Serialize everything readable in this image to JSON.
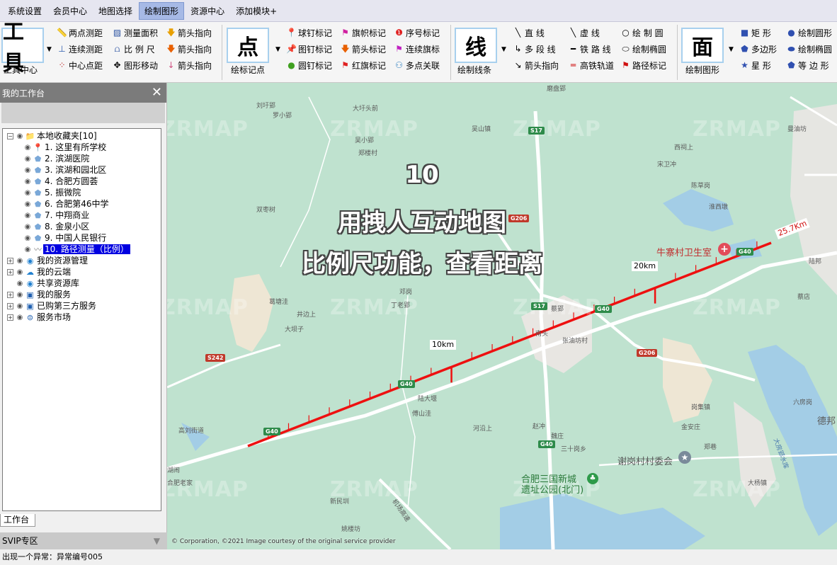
{
  "menu": [
    "系统设置",
    "会员中心",
    "地图选择",
    "绘制图形",
    "资源中心",
    "添加模块+"
  ],
  "ribbon": {
    "tool_group": {
      "big": "工具",
      "label": "工具中心",
      "buttons": [
        [
          "两点测距",
          "测量面积",
          "箭头指向"
        ],
        [
          "连续测距",
          "比 例 尺",
          "箭头指向"
        ],
        [
          "中心点距",
          "图形移动",
          "箭头指向"
        ]
      ]
    },
    "point_group": {
      "big": "点",
      "label": "绘标记点",
      "buttons": [
        [
          "球钉标记",
          "旗帜标记",
          "序号标记"
        ],
        [
          "图钉标记",
          "箭头标记",
          "连续旗标"
        ],
        [
          "圆钉标记",
          "红旗标记",
          "多点关联"
        ]
      ]
    },
    "line_group": {
      "big": "线",
      "label": "绘制线条",
      "buttons": [
        [
          "直  线",
          "虚  线",
          "绘 制 圆"
        ],
        [
          "多 段 线",
          "铁 路 线",
          "绘制椭圆"
        ],
        [
          "箭头指向",
          "高铁轨道",
          "路径标记"
        ]
      ]
    },
    "face_group": {
      "big": "面",
      "label": "绘制图形",
      "buttons": [
        [
          "矩  形",
          "绘制圆形"
        ],
        [
          "多边形",
          "绘制椭圆"
        ],
        [
          "星  形",
          "等 边 形"
        ]
      ]
    }
  },
  "sidebar": {
    "title": "我的工作台",
    "tree": {
      "root": "本地收藏夹[10]",
      "items": [
        "1. 这里有所学校",
        "2. 滨湖医院",
        "3. 滨湖和园北区",
        "4. 合肥方圆荟",
        "5. 振微院",
        "6. 合肥第46中学",
        "7. 中翔商业",
        "8. 金泉小区",
        "9. 中国人民银行",
        "10. 路径测量（比例）"
      ],
      "others": [
        "我的资源管理",
        "我的云端",
        "共享资源库",
        "我的服务",
        "已购第三方服务",
        "服务市场"
      ]
    },
    "tab": "工作台",
    "svip": "SVIP专区"
  },
  "map": {
    "overlay": [
      "10",
      "用拽人互动地图",
      "比例尺功能，查看距离"
    ],
    "watermark": "ZRMAP",
    "km_labels": [
      "10km",
      "20km",
      "25.7Km"
    ],
    "pois": [
      "牛寨村卫生室",
      "谢岗村村委会",
      "合肥三国新城",
      "遗址公园(北门)"
    ],
    "roads": [
      "S17",
      "G206",
      "G40",
      "S242"
    ],
    "places": [
      "磨盘郢",
      "刘圩郢",
      "罗小郢",
      "大圩头前",
      "吴山镇",
      "吴小郢",
      "郑楼村",
      "西祠上",
      "曼油坊",
      "双枣树",
      "宋卫冲",
      "陈草岗",
      "淮西墩",
      "陆邦",
      "蔡店",
      "邓岗",
      "葛塘洼",
      "丁老郢",
      "井边上",
      "大坝子",
      "蔡郢",
      "张油坊村",
      "南头",
      "陆大堰",
      "傅山洼",
      "河沿上",
      "赵冲",
      "魏庄",
      "三十岗乡",
      "岗集镇",
      "金安庄",
      "郑巷",
      "六房岗",
      "高刘街道",
      "新民圳",
      "姚楼坊",
      "大杨镇",
      "德邦",
      "大房郢水库",
      "机场高速",
      "合肥老家",
      "湖闹"
    ],
    "copyright": "© Corporation, ©2021 Image courtesy of the original service provider"
  },
  "status": "出现一个异常：异常编号005"
}
